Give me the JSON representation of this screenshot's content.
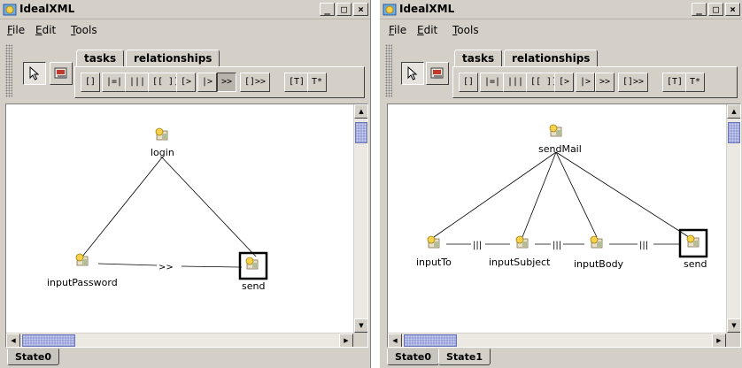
{
  "left": {
    "title": "IdealXML",
    "window_buttons": {
      "minimize": "_",
      "maximize": "□",
      "close": "×"
    },
    "menus": [
      "File",
      "Edit",
      "Tools"
    ],
    "tabs": [
      "tasks",
      "relationships"
    ],
    "active_tab": "relationships",
    "operators": [
      "[]",
      "|=|",
      "|||",
      "[[ ]]",
      "[>",
      "|>",
      ">>",
      "[]>>",
      "[T]",
      "T*"
    ],
    "selected_operator": ">>",
    "diagram": {
      "nodes": [
        "login",
        "inputPassword",
        "send"
      ],
      "selected_node": "send",
      "edge_label": ">>"
    },
    "state_tabs": [
      "State0"
    ],
    "active_state": "State0"
  },
  "right": {
    "title": "IdealXML",
    "window_buttons": {
      "minimize": "_",
      "maximize": "□",
      "close": "×"
    },
    "menus": [
      "File",
      "Edit",
      "Tools"
    ],
    "tabs": [
      "tasks",
      "relationships"
    ],
    "active_tab": "relationships",
    "operators": [
      "[]",
      "|=|",
      "|||",
      "[[ ]]",
      "[>",
      "|>",
      ">>",
      "[]>>",
      "[T]",
      "T*"
    ],
    "diagram": {
      "nodes": [
        "sendMail",
        "inputTo",
        "inputSubject",
        "inputBody",
        "send"
      ],
      "selected_node": "send",
      "edge_label": "|||"
    },
    "state_tabs": [
      "State0",
      "State1"
    ],
    "active_state": "State0"
  },
  "colors": {
    "window_bg": "#d4d0c8",
    "canvas_bg": "#ffffff",
    "scroll_thumb": "#9aa3d8",
    "selection_border": "#000000"
  }
}
